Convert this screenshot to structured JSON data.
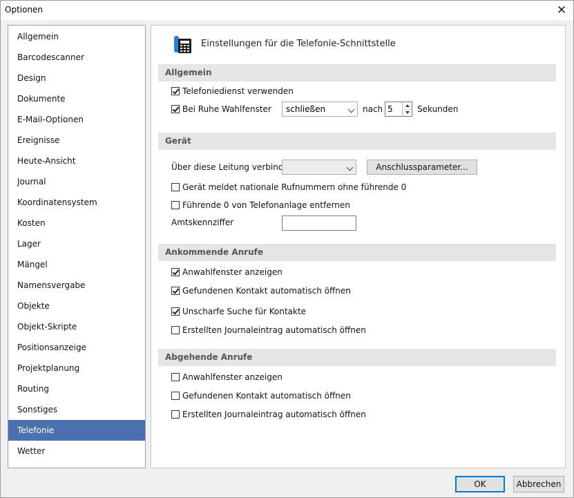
{
  "window": {
    "title": "Optionen"
  },
  "nav": {
    "items": [
      {
        "label": "Allgemein"
      },
      {
        "label": "Barcodescanner"
      },
      {
        "label": "Design"
      },
      {
        "label": "Dokumente"
      },
      {
        "label": "E-Mail-Optionen"
      },
      {
        "label": "Ereignisse"
      },
      {
        "label": "Heute-Ansicht"
      },
      {
        "label": "Journal"
      },
      {
        "label": "Koordinatensystem"
      },
      {
        "label": "Kosten"
      },
      {
        "label": "Lager"
      },
      {
        "label": "Mängel"
      },
      {
        "label": "Namensvergabe"
      },
      {
        "label": "Objekte"
      },
      {
        "label": "Objekt-Skripte"
      },
      {
        "label": "Positionsanzeige"
      },
      {
        "label": "Projektplanung"
      },
      {
        "label": "Routing"
      },
      {
        "label": "Sonstiges"
      },
      {
        "label": "Telefonie"
      },
      {
        "label": "Wetter"
      }
    ],
    "selected": "Telefonie"
  },
  "panel": {
    "title": "Einstellungen für die Telefonie-Schnittstelle",
    "icon": "phone-calculator-icon",
    "general": {
      "header": "Allgemein",
      "use_service_label": "Telefoniedienst verwenden",
      "use_service_checked": true,
      "idle_label": "Bei Ruhe Wahlfenster",
      "idle_checked": true,
      "idle_action": "schließen",
      "after_label": "nach",
      "seconds_value": "5",
      "seconds_label": "Sekunden"
    },
    "device": {
      "header": "Gerät",
      "line_label": "Über diese Leitung verbinden",
      "line_value": "",
      "params_button": "Anschlussparameter...",
      "national_label": "Gerät meldet nationale Rufnummern ohne führende 0",
      "national_checked": false,
      "leading_zero_label": "Führende 0 von Telefonanlage entfernen",
      "leading_zero_checked": false,
      "trunk_code_label": "Amtskennziffer",
      "trunk_code_value": ""
    },
    "incoming": {
      "header": "Ankommende Anrufe",
      "show_dialog_label": "Anwahlfenster anzeigen",
      "show_dialog_checked": true,
      "open_contact_label": "Gefundenen Kontakt automatisch öffnen",
      "open_contact_checked": true,
      "fuzzy_label": "Unscharfe Suche für Kontakte",
      "fuzzy_checked": true,
      "open_journal_label": "Erstellten Journaleintrag automatisch öffnen",
      "open_journal_checked": false
    },
    "outgoing": {
      "header": "Abgehende Anrufe",
      "show_dialog_label": "Anwahlfenster anzeigen",
      "show_dialog_checked": false,
      "open_contact_label": "Gefundenen Kontakt automatisch öffnen",
      "open_contact_checked": false,
      "open_journal_label": "Erstellten Journaleintrag automatisch öffnen",
      "open_journal_checked": false
    }
  },
  "footer": {
    "ok_label": "OK",
    "cancel_label": "Abbrechen"
  },
  "colors": {
    "selection": "#4a70b0",
    "icon_blue": "#2a7fd4",
    "section_bg": "#e5e5e5"
  }
}
